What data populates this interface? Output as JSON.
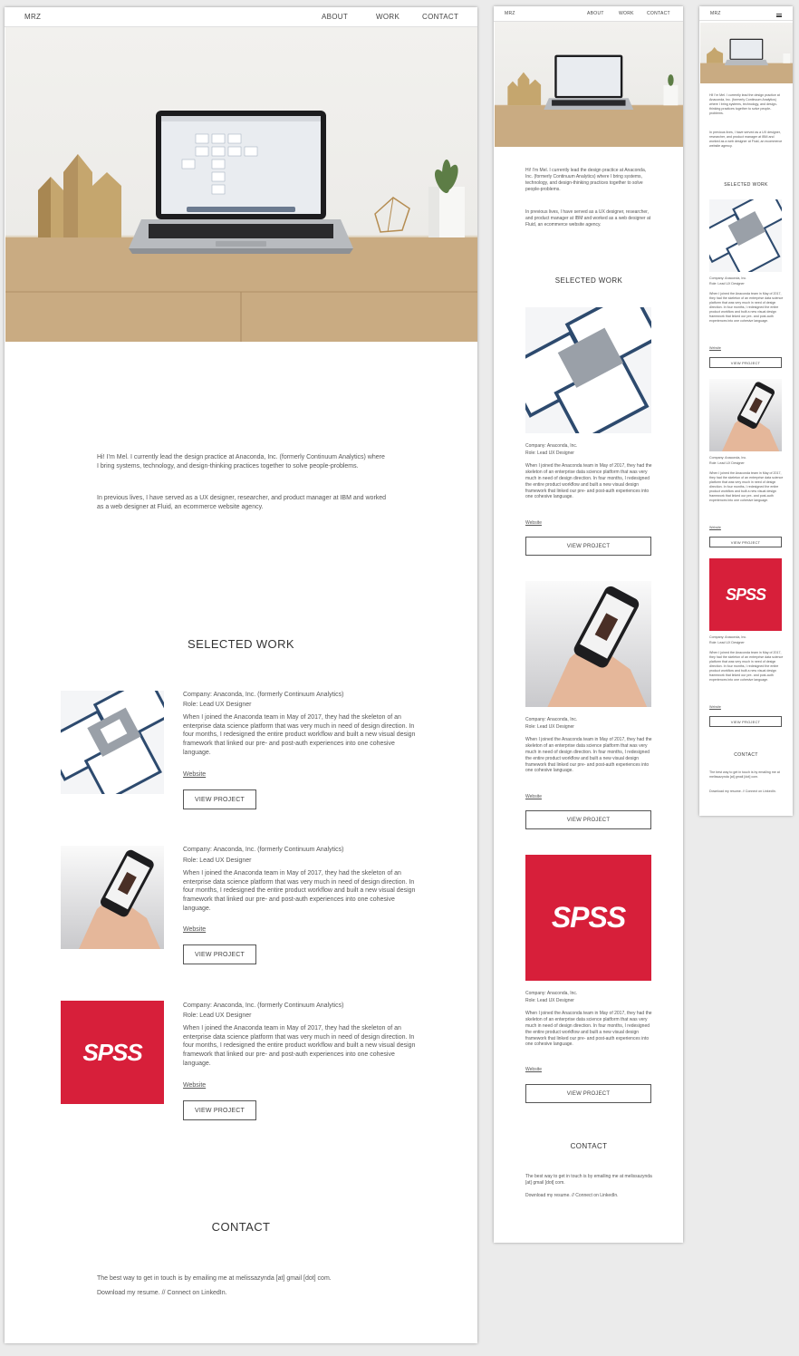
{
  "brand": "MRZ",
  "nav": {
    "about": "ABOUT",
    "work": "WORK",
    "contact": "CONTACT"
  },
  "intro": {
    "p1": "Hi!  I’m Mel.  I currently lead the design practice at Anaconda, Inc. (formerly Continuum Analytics) where I bring systems, technology, and design-thinking practices together to solve people-problems.",
    "p2": "In previous lives, I have served as a UX designer, researcher, and product manager at IBM and worked as a web designer at Fluid, an ecommerce website agency."
  },
  "selected_work_heading": "SELECTED WORK",
  "projects": [
    {
      "company": "Company: Anaconda, Inc. (formerly Continuum Analytics)",
      "company_short": "Company: Anaconda, Inc.",
      "role": "Role: Lead UX Designer",
      "description": "When I joined the Anaconda team in May of 2017, they had the skeleton of an enterprise data science platform that was very much in need of design direction.  In four months, I redesigned the entire product workflow and built a new visual design framework that linked our pre- and post-auth experiences into one cohesive language.",
      "link": "Website",
      "button": "VIEW PROJECT",
      "thumb": "screens"
    },
    {
      "company": "Company: Anaconda, Inc. (formerly Continuum Analytics)",
      "company_short": "Company: Anaconda, Inc.",
      "role": "Role: Lead UX Designer",
      "description": "When I joined the Anaconda team in May of 2017, they had the skeleton of an enterprise data science platform that was very much in need of design direction.  In four months, I redesigned the entire product workflow and built a new visual design framework that linked our pre- and post-auth experiences into one cohesive language.",
      "link": "Website",
      "button": "VIEW PROJECT",
      "thumb": "phone"
    },
    {
      "company": "Company: Anaconda, Inc. (formerly Continuum Analytics)",
      "company_short": "Company: Anaconda, Inc.",
      "role": "Role: Lead UX Designer",
      "description": "When I joined the Anaconda team in May of 2017, they had the skeleton of an enterprise data science platform that was very much in need of design direction.  In four months, I redesigned the entire product workflow and built a new visual design framework that linked our pre- and post-auth experiences into one cohesive language.",
      "link": "Website",
      "button": "VIEW PROJECT",
      "thumb": "spss-logo",
      "logo_text": "SPSS"
    }
  ],
  "contact": {
    "heading": "CONTACT",
    "email_line": "The best way to get in touch is by emailing me at melissazynda [at] gmail [dot] com.",
    "links_line": "Download my resume.  //  Connect on LinkedIn."
  },
  "colors": {
    "spss_red": "#d71f3a",
    "screen_navy": "#2d4a6e"
  }
}
